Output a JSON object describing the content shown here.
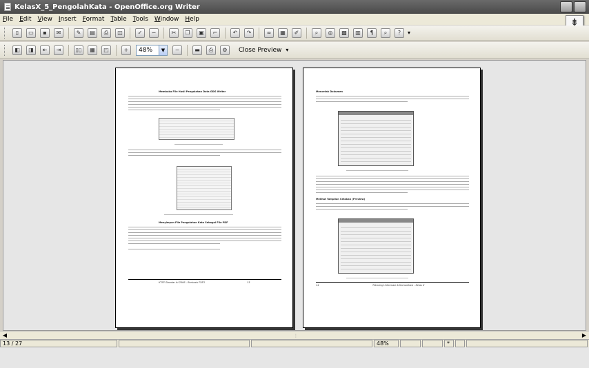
{
  "window": {
    "title": "KelasX_5_PengolahKata - OpenOffice.org Writer"
  },
  "menu": [
    "File",
    "Edit",
    "View",
    "Insert",
    "Format",
    "Table",
    "Tools",
    "Window",
    "Help"
  ],
  "preview_toolbar": {
    "zoom": "48%",
    "close_preview": "Close Preview"
  },
  "status": {
    "page": "13 / 27",
    "zoom": "48%"
  },
  "left_page": {
    "heading1": "Membuka File Hasil Pengolahan Data ODG Writer",
    "heading2": "Menyimpan File Pengolahan Kata Sebagai File PDF",
    "footer_left": "KTSP Standar Isi 2006 - Berbasis P2E3",
    "footer_right": "13"
  },
  "right_page": {
    "heading1": "Mencetak Dokumen",
    "heading2": "Melihat Tampilan Cetakan (Preview)",
    "footer_left": "14",
    "footer_right": "Teknologi Informasi & Komunikasi - Kelas X"
  }
}
